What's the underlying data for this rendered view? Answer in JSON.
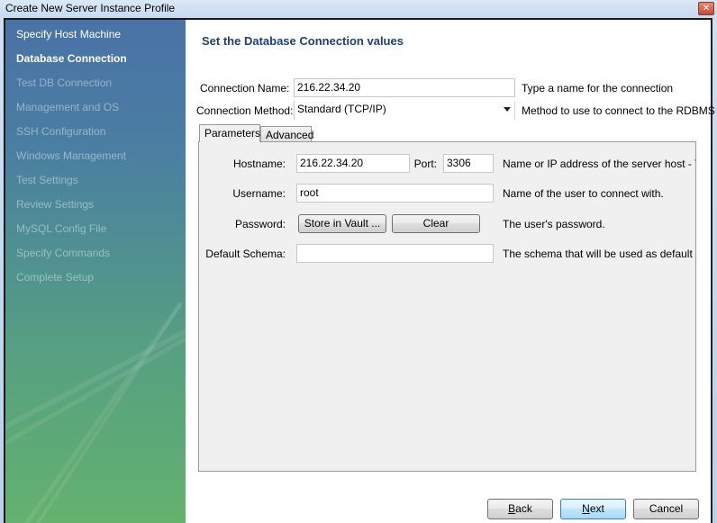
{
  "window": {
    "title": "Create New Server Instance Profile",
    "close_icon": "close-x-icon"
  },
  "sidebar": {
    "items": [
      {
        "label": "Specify Host Machine",
        "state": "done"
      },
      {
        "label": "Database Connection",
        "state": "active"
      },
      {
        "label": "Test DB Connection",
        "state": "pending"
      },
      {
        "label": "Management and OS",
        "state": "pending"
      },
      {
        "label": "SSH Configuration",
        "state": "pending"
      },
      {
        "label": "Windows Management",
        "state": "pending"
      },
      {
        "label": "Test Settings",
        "state": "pending"
      },
      {
        "label": "Review Settings",
        "state": "pending"
      },
      {
        "label": "MySQL Config File",
        "state": "pending"
      },
      {
        "label": "Specify Commands",
        "state": "pending"
      },
      {
        "label": "Complete Setup",
        "state": "pending"
      }
    ]
  },
  "main": {
    "title": "Set the Database Connection values",
    "connection_name": {
      "label": "Connection Name:",
      "value": "216.22.34.20",
      "hint": "Type a name for the connection"
    },
    "connection_method": {
      "label": "Connection Method:",
      "value": "Standard (TCP/IP)",
      "hint": "Method to use to connect to the RDBMS"
    },
    "tabs": [
      {
        "label": "Parameters",
        "active": true
      },
      {
        "label": "Advanced",
        "active": false
      }
    ],
    "parameters": {
      "hostname": {
        "label": "Hostname:",
        "value": "216.22.34.20"
      },
      "port": {
        "label": "Port:",
        "value": "3306"
      },
      "hostname_hint": "Name or IP address of the server host - TCP",
      "username": {
        "label": "Username:",
        "value": "root",
        "hint": "Name of the user to connect with."
      },
      "password": {
        "label": "Password:",
        "store_button": "Store in Vault ...",
        "clear_button": "Clear",
        "hint": "The user's password."
      },
      "default_schema": {
        "label": "Default Schema:",
        "value": "",
        "hint": "The schema that will be used as default sche"
      }
    }
  },
  "footer": {
    "back_prefix": "B",
    "back_rest": "ack",
    "next_prefix": "N",
    "next_rest": "ext",
    "cancel": "Cancel"
  }
}
